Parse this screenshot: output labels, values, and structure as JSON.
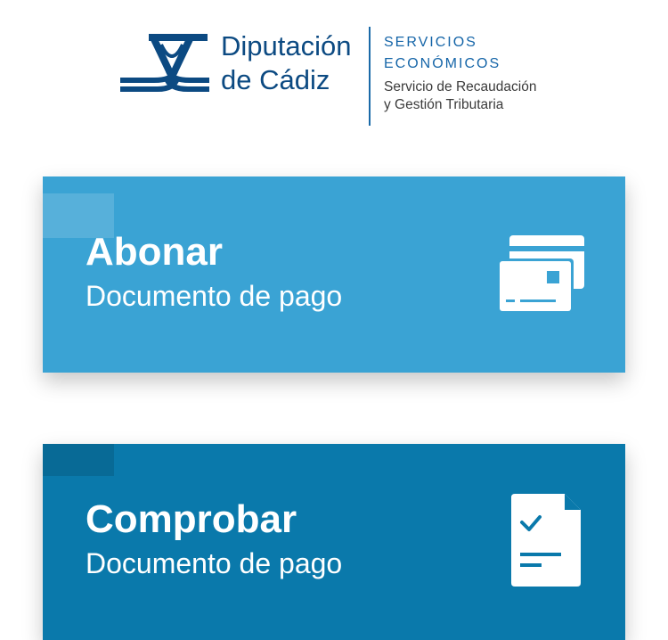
{
  "header": {
    "org_name_line1": "Diputación",
    "org_name_line2": "de Cádiz",
    "dept_title_line1": "SERVICIOS",
    "dept_title_line2": "ECONÓMICOS",
    "dept_sub_line1": "Servicio de Recaudación",
    "dept_sub_line2": "y Gestión Tributaria",
    "logo_color": "#0c4a82"
  },
  "cards": [
    {
      "title": "Abonar",
      "subtitle": "Documento de pago",
      "icon": "credit-card-icon",
      "color": "#3aa3d4"
    },
    {
      "title": "Comprobar",
      "subtitle": "Documento de pago",
      "icon": "document-check-icon",
      "color": "#0a79ab"
    }
  ]
}
